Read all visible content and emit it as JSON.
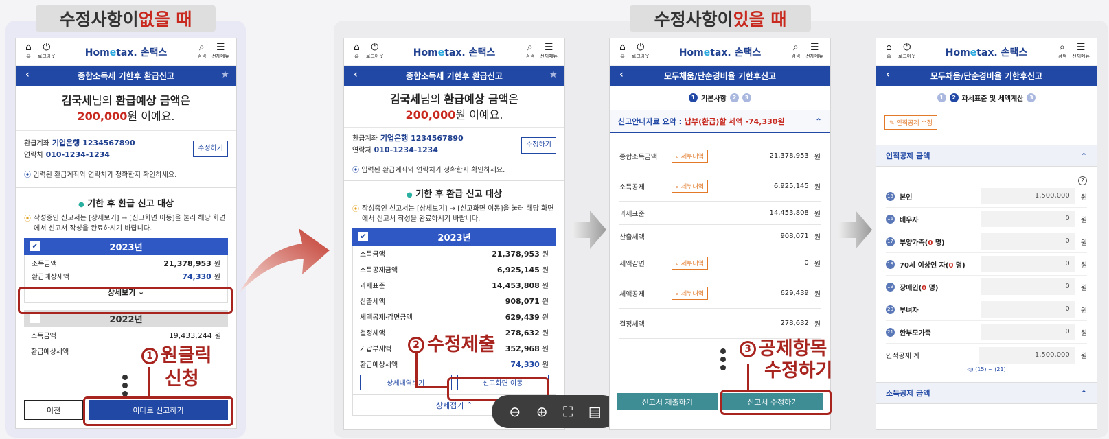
{
  "headers": {
    "left": {
      "pre": "수정사항이 ",
      "hl": "없을 때"
    },
    "right": {
      "pre": "수정사항이 ",
      "hl": "있을 때"
    }
  },
  "topbar": {
    "home": "홈",
    "logout": "로그아웃",
    "logo_pre": "Hom",
    "logo_e": "e",
    "logo_post": "tax. 손택스",
    "search": "검색",
    "menu": "전체메뉴"
  },
  "screen1": {
    "title": "종합소득세 기한후 환급신고",
    "refund_name": "김국세",
    "refund_mid1": "님의 ",
    "refund_bold": "환급예상 금액",
    "refund_mid2": "은",
    "refund_amount": "200,000",
    "refund_tail": "원 이예요.",
    "acct_label": "환급계좌",
    "acct_value": "기업은행 1234567890",
    "phone_label": "연락처",
    "phone_value": "010-1234-1234",
    "edit": "수정하기",
    "note": "입력된 환급계좌와 연락처가 정확한지 확인하세요.",
    "section": "기한 후 환급 신고 대상",
    "warn": "작성중인 신고서는 [상세보기] → [신고화면 이동]을 눌러 해당 화면에서 신고서 작성을 완료하시기 바랍니다.",
    "year1": "2023년",
    "y1rows": [
      {
        "k": "소득금액",
        "v": "21,378,953",
        "u": "원"
      },
      {
        "k": "환급예상세액",
        "v": "74,330",
        "u": "원"
      }
    ],
    "detail": "상세보기",
    "year2": "2022년",
    "y2rows": [
      {
        "k": "소득금액",
        "v": "19,433,244",
        "u": "원"
      },
      {
        "k": "환급예상세액",
        "v": "",
        "u": ""
      }
    ],
    "prev": "이전",
    "submit": "이대로 신고하기",
    "ann_num": "1",
    "ann_l1": "원클릭",
    "ann_l2": "신청"
  },
  "screen2": {
    "title": "종합소득세 기한후 환급신고",
    "year1": "2023년",
    "rows": [
      {
        "k": "소득금액",
        "v": "21,378,953",
        "u": "원"
      },
      {
        "k": "소득공제금액",
        "v": "6,925,145",
        "u": "원"
      },
      {
        "k": "과세표준",
        "v": "14,453,808",
        "u": "원"
      },
      {
        "k": "산출세액",
        "v": "908,071",
        "u": "원"
      },
      {
        "k": "세액공제·감면금액",
        "v": "629,439",
        "u": "원"
      },
      {
        "k": "결정세액",
        "v": "278,632",
        "u": "원"
      },
      {
        "k": "기납부세액",
        "v": "352,968",
        "u": "원"
      },
      {
        "k": "환급예상세액",
        "v": "74,330",
        "u": "원"
      }
    ],
    "btn_detail": "상세내역보기",
    "btn_move": "신고화면 이동",
    "collapse": "상세접기",
    "ann_num": "2",
    "ann": "수정제출"
  },
  "screen3": {
    "title": "모두채움/단순경비율 기한후신고",
    "step1": "1",
    "step1_label": "기본사항",
    "step2": "2",
    "step3": "3",
    "summary_label": "신고안내자료 요약 : ",
    "summary_value": "납부(환급)할 세액 -74,330원",
    "rows": [
      {
        "k": "종합소득금액",
        "tag": "세부내역",
        "v": "21,378,953",
        "u": "원"
      },
      {
        "k": "소득공제",
        "tag": "세부내역",
        "v": "6,925,145",
        "u": "원"
      },
      {
        "k": "과세표준",
        "tag": "",
        "v": "14,453,808",
        "u": "원"
      },
      {
        "k": "산출세액",
        "tag": "",
        "v": "908,071",
        "u": "원"
      },
      {
        "k": "세액감면",
        "tag": "세부내역",
        "v": "0",
        "u": "원"
      },
      {
        "k": "세액공제",
        "tag": "세부내역",
        "v": "629,439",
        "u": "원"
      },
      {
        "k": "결정세액",
        "tag": "",
        "v": "278,632",
        "u": "원"
      }
    ],
    "btn_submit": "신고서 제출하기",
    "btn_edit": "신고서 수정하기",
    "ann_num": "3",
    "ann_l1": "공제항목",
    "ann_l2": "수정하기"
  },
  "screen4": {
    "title": "모두채움/단순경비율 기한후신고",
    "step1": "1",
    "step2": "2",
    "step2_label": "과세표준 및 세액계산",
    "step3": "3",
    "edit_personal": "인적공제 수정",
    "section": "인적공제 금액",
    "help": "?",
    "rows": [
      {
        "n": "15",
        "k": "본인",
        "cnt": "",
        "v": "1,500,000",
        "u": "원"
      },
      {
        "n": "16",
        "k": "배우자",
        "cnt": "",
        "v": "0",
        "u": "원"
      },
      {
        "n": "17",
        "k": "부양가족(",
        "cnt": "0",
        "k2": " 명)",
        "v": "0",
        "u": "원"
      },
      {
        "n": "18",
        "k": "70세 이상인 자(",
        "cnt": "0",
        "k2": " 명)",
        "v": "0",
        "u": "원"
      },
      {
        "n": "19",
        "k": "장애인(",
        "cnt": "0",
        "k2": " 명)",
        "v": "0",
        "u": "원"
      },
      {
        "n": "20",
        "k": "부녀자",
        "cnt": "",
        "v": "0",
        "u": "원"
      },
      {
        "n": "21",
        "k": "한부모가족",
        "cnt": "",
        "v": "0",
        "u": "원"
      }
    ],
    "total_label": "인적공제 계",
    "total_value": "1,500,000",
    "total_unit": "원",
    "range": "(15) ~ (21)",
    "section2": "소득공제 금액"
  },
  "colors": {
    "blue": "#2148a4",
    "red": "#c8281e",
    "annotation": "#a8241f",
    "teal": "#3e8c94",
    "tag": "#e27a2a"
  }
}
